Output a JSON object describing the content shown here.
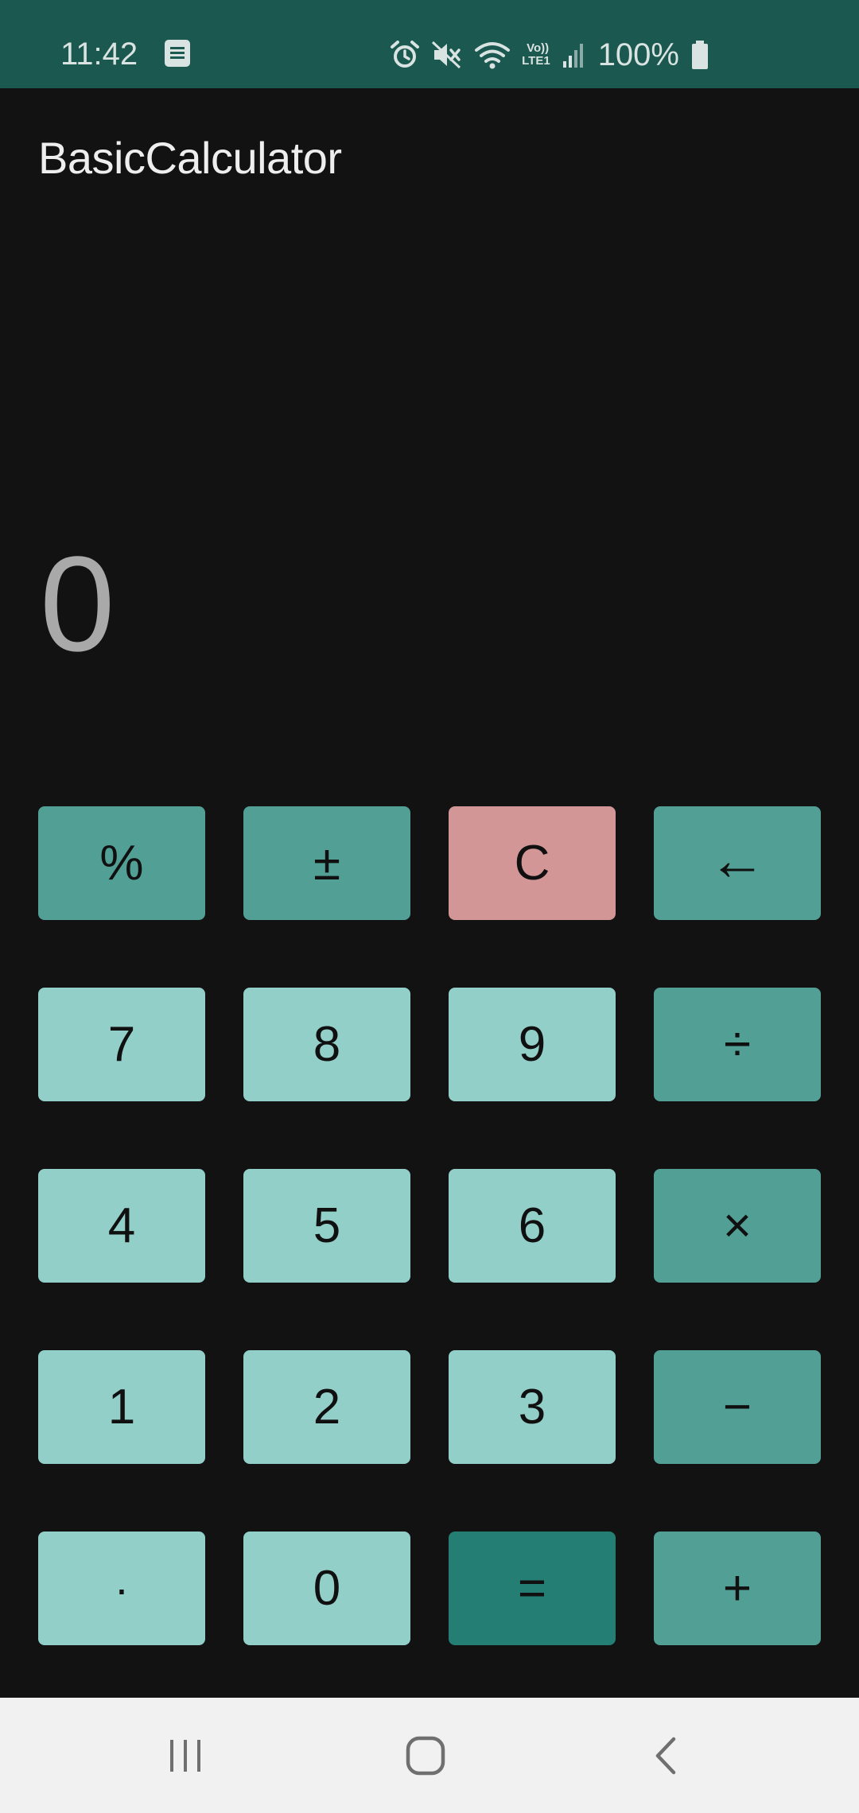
{
  "status_bar": {
    "time": "11:42",
    "battery": "100%",
    "icons": [
      "notes-icon",
      "alarm-icon",
      "mute-icon",
      "wifi-icon",
      "volte-icon",
      "signal-icon",
      "battery-icon"
    ],
    "volte_label_top": "Vo))",
    "volte_label_bottom": "LTE1"
  },
  "app_bar": {
    "title": "BasicCalculator"
  },
  "display": {
    "value": "0"
  },
  "keypad": {
    "rows": [
      [
        {
          "label": "%",
          "kind": "op"
        },
        {
          "label": "±",
          "kind": "op"
        },
        {
          "label": "C",
          "kind": "clear"
        },
        {
          "label": "←",
          "kind": "op"
        }
      ],
      [
        {
          "label": "7",
          "kind": "num"
        },
        {
          "label": "8",
          "kind": "num"
        },
        {
          "label": "9",
          "kind": "num"
        },
        {
          "label": "÷",
          "kind": "op"
        }
      ],
      [
        {
          "label": "4",
          "kind": "num"
        },
        {
          "label": "5",
          "kind": "num"
        },
        {
          "label": "6",
          "kind": "num"
        },
        {
          "label": "×",
          "kind": "op"
        }
      ],
      [
        {
          "label": "1",
          "kind": "num"
        },
        {
          "label": "2",
          "kind": "num"
        },
        {
          "label": "3",
          "kind": "num"
        },
        {
          "label": "−",
          "kind": "op"
        }
      ],
      [
        {
          "label": "·",
          "kind": "num"
        },
        {
          "label": "0",
          "kind": "num"
        },
        {
          "label": "=",
          "kind": "eq"
        },
        {
          "label": "+",
          "kind": "op"
        }
      ]
    ]
  },
  "colors": {
    "status_bar": "#1b584f",
    "background": "#121212",
    "number_key": "#93cfc9",
    "operator_key": "#529f95",
    "clear_key": "#d29696",
    "equals_key": "#257e73",
    "nav_bar": "#f1f1f1"
  },
  "nav_bar": {
    "buttons": [
      "recent-apps-icon",
      "home-icon",
      "back-icon"
    ]
  }
}
